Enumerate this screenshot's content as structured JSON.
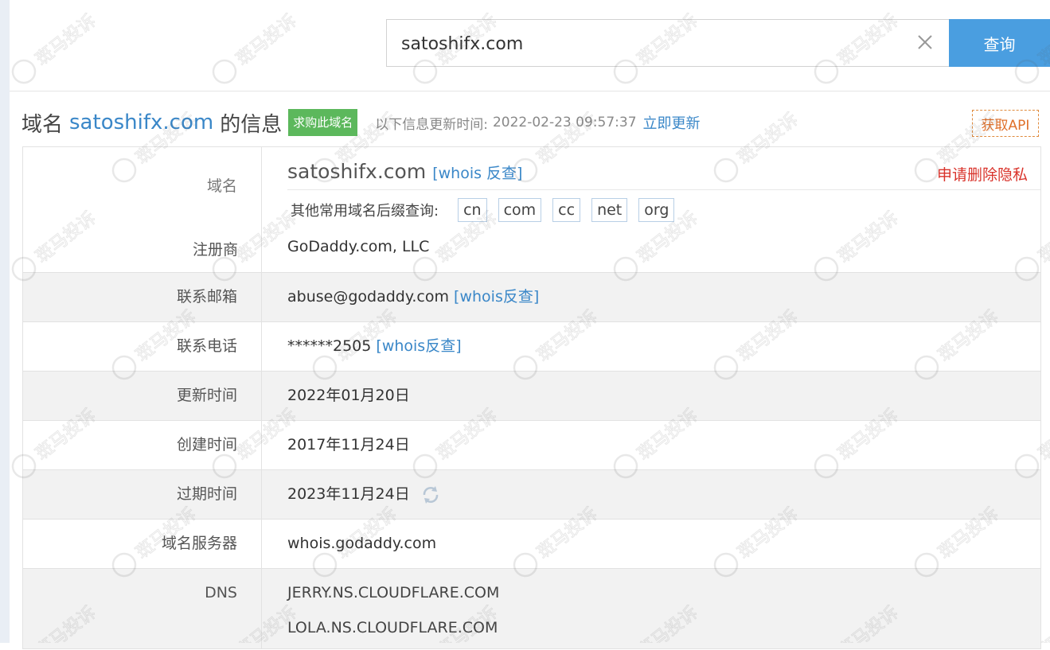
{
  "search": {
    "value": "satoshifx.com",
    "button_label": "查询"
  },
  "heading": {
    "prefix": "域名",
    "domain": "satoshifx.com",
    "suffix": "的信息",
    "buy_label": "求购此域名",
    "update_text": "以下信息更新时间:",
    "update_time": "2022-02-23 09:57:37",
    "update_link": "立即更新",
    "api_label": "获取API"
  },
  "domain_row": {
    "label": "域名",
    "name": "satoshifx.com",
    "whois_link": "[whois 反查]",
    "privacy_link": "申请删除隐私",
    "suffix_label": "其他常用域名后缀查询:",
    "suffixes": [
      "cn",
      "com",
      "cc",
      "net",
      "org"
    ]
  },
  "registrar": {
    "label": "注册商",
    "value": "GoDaddy.com, LLC"
  },
  "email": {
    "label": "联系邮箱",
    "value": "abuse@godaddy.com",
    "link": "[whois反查]"
  },
  "phone": {
    "label": "联系电话",
    "value": "******2505",
    "link": "[whois反查]"
  },
  "updated": {
    "label": "更新时间",
    "value": "2022年01月20日"
  },
  "created": {
    "label": "创建时间",
    "value": "2017年11月24日"
  },
  "expires": {
    "label": "过期时间",
    "value": "2023年11月24日"
  },
  "whois_server": {
    "label": "域名服务器",
    "value": "whois.godaddy.com"
  },
  "dns": {
    "label": "DNS",
    "servers": [
      "JERRY.NS.CLOUDFLARE.COM",
      "LOLA.NS.CLOUDFLARE.COM"
    ]
  },
  "watermark": {
    "text": "斑马投诉"
  },
  "colors": {
    "link": "#3a87c8",
    "search_button": "#4a9ee0",
    "buy_button": "#5cb85c",
    "privacy": "#d9332b",
    "api": "#e0702a"
  },
  "icons": {
    "clear": "close-icon",
    "refresh": "refresh-icon"
  }
}
